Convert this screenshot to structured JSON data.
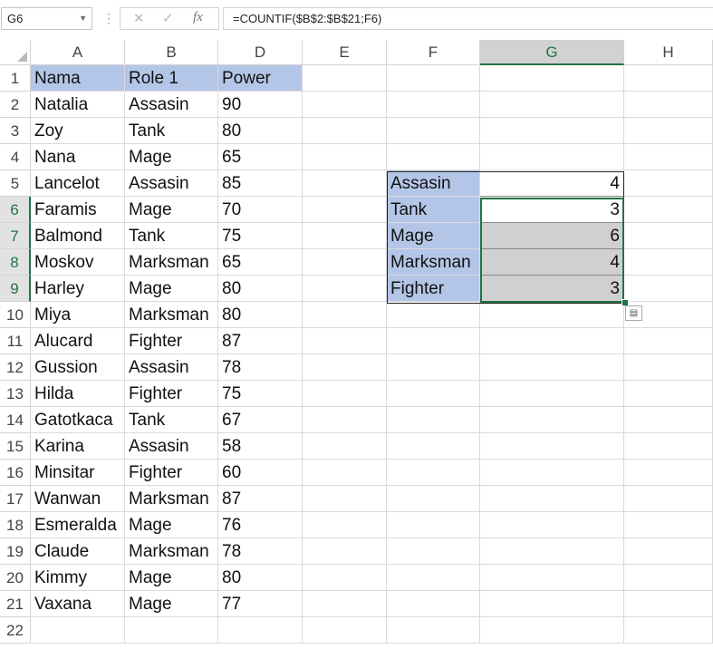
{
  "formula_bar": {
    "name_box": "G6",
    "formula": "=COUNTIF($B$2:$B$21;F6)"
  },
  "columns": [
    "A",
    "B",
    "D",
    "E",
    "F",
    "G",
    "H"
  ],
  "selected_column": "G",
  "rows": [
    "1",
    "2",
    "3",
    "4",
    "5",
    "6",
    "7",
    "8",
    "9",
    "10",
    "11",
    "12",
    "13",
    "14",
    "15",
    "16",
    "17",
    "18",
    "19",
    "20",
    "21",
    "22"
  ],
  "selected_rows": [
    "6",
    "7",
    "8",
    "9"
  ],
  "table": {
    "headers": [
      "Nama",
      "Role 1",
      "Power"
    ],
    "records": [
      [
        "Natalia",
        "Assasin",
        "90"
      ],
      [
        "Zoy",
        "Tank",
        "80"
      ],
      [
        "Nana",
        "Mage",
        "65"
      ],
      [
        "Lancelot",
        "Assasin",
        "85"
      ],
      [
        "Faramis",
        "Mage",
        "70"
      ],
      [
        "Balmond",
        "Tank",
        "75"
      ],
      [
        "Moskov",
        "Marksman",
        "65"
      ],
      [
        "Harley",
        "Mage",
        "80"
      ],
      [
        "Miya",
        "Marksman",
        "80"
      ],
      [
        "Alucard",
        "Fighter",
        "87"
      ],
      [
        "Gussion",
        "Assasin",
        "78"
      ],
      [
        "Hilda",
        "Fighter",
        "75"
      ],
      [
        "Gatotkaca",
        "Tank",
        "67"
      ],
      [
        "Karina",
        "Assasin",
        "58"
      ],
      [
        "Minsitar",
        "Fighter",
        "60"
      ],
      [
        "Wanwan",
        "Marksman",
        "87"
      ],
      [
        "Esmeralda",
        "Mage",
        "76"
      ],
      [
        "Claude",
        "Marksman",
        "78"
      ],
      [
        "Kimmy",
        "Mage",
        "80"
      ],
      [
        "Vaxana",
        "Mage",
        "77"
      ]
    ]
  },
  "summary": [
    {
      "role": "Assasin",
      "count": "4"
    },
    {
      "role": "Tank",
      "count": "3"
    },
    {
      "role": "Mage",
      "count": "6"
    },
    {
      "role": "Marksman",
      "count": "4"
    },
    {
      "role": "Fighter",
      "count": "3"
    }
  ],
  "colors": {
    "header_fill": "#b4c6e7",
    "selection": "#217346",
    "selection_shade": "#d0d0d0"
  }
}
